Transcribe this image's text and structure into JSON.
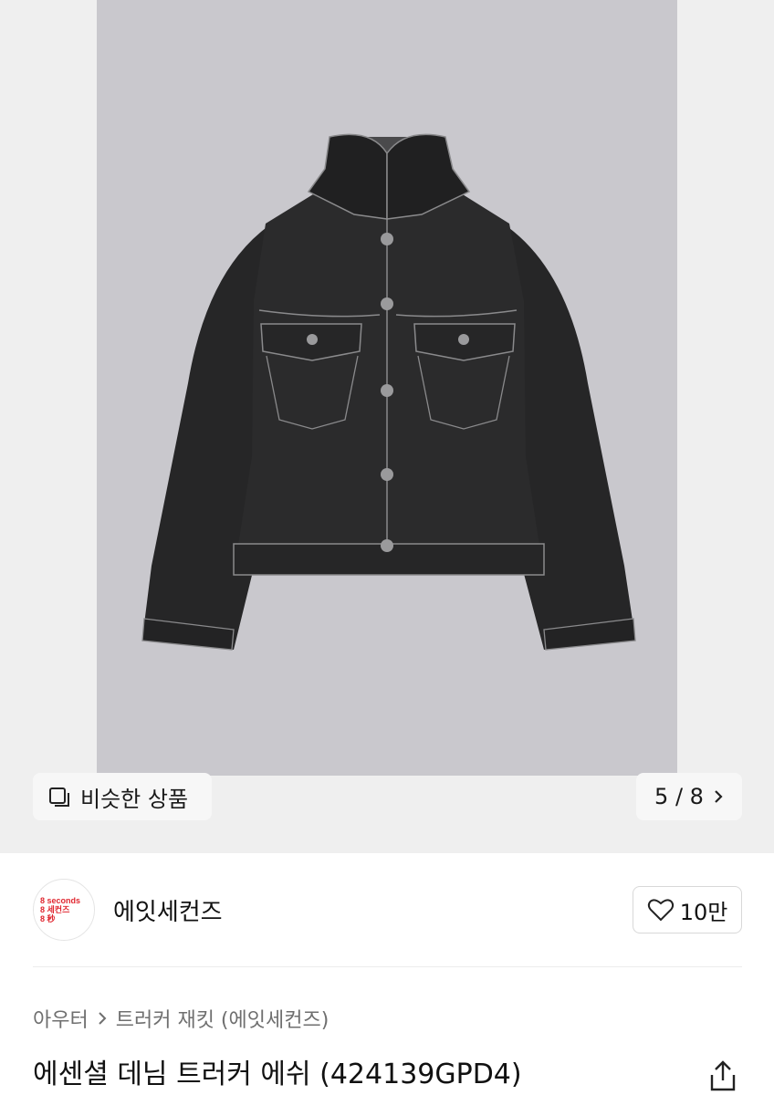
{
  "hero": {
    "image_alt": "black denim trucker jacket product photo",
    "similar_button": {
      "label": "비슷한 상품",
      "icon": "similar-items-icon"
    },
    "counter": {
      "text": "5 / 8",
      "icon": "chevron-right-icon"
    }
  },
  "brand": {
    "logo_lines": [
      "8 seconds",
      "8 세컨즈",
      "8 秒"
    ],
    "name": "에잇세컨즈",
    "likes": {
      "count": "10만",
      "icon": "heart-outline-icon"
    }
  },
  "breadcrumb": {
    "category": "아우터",
    "subcategory": "트러커 재킷 (에잇세컨즈)"
  },
  "product": {
    "title": "에센셜 데님 트러커 에쉬 (424139GPD4)",
    "share_icon": "share-icon"
  },
  "colors": {
    "logo_red": "#e0262f",
    "photo_bg": "#c9c8cd",
    "jacket": "#2a2a2b"
  }
}
